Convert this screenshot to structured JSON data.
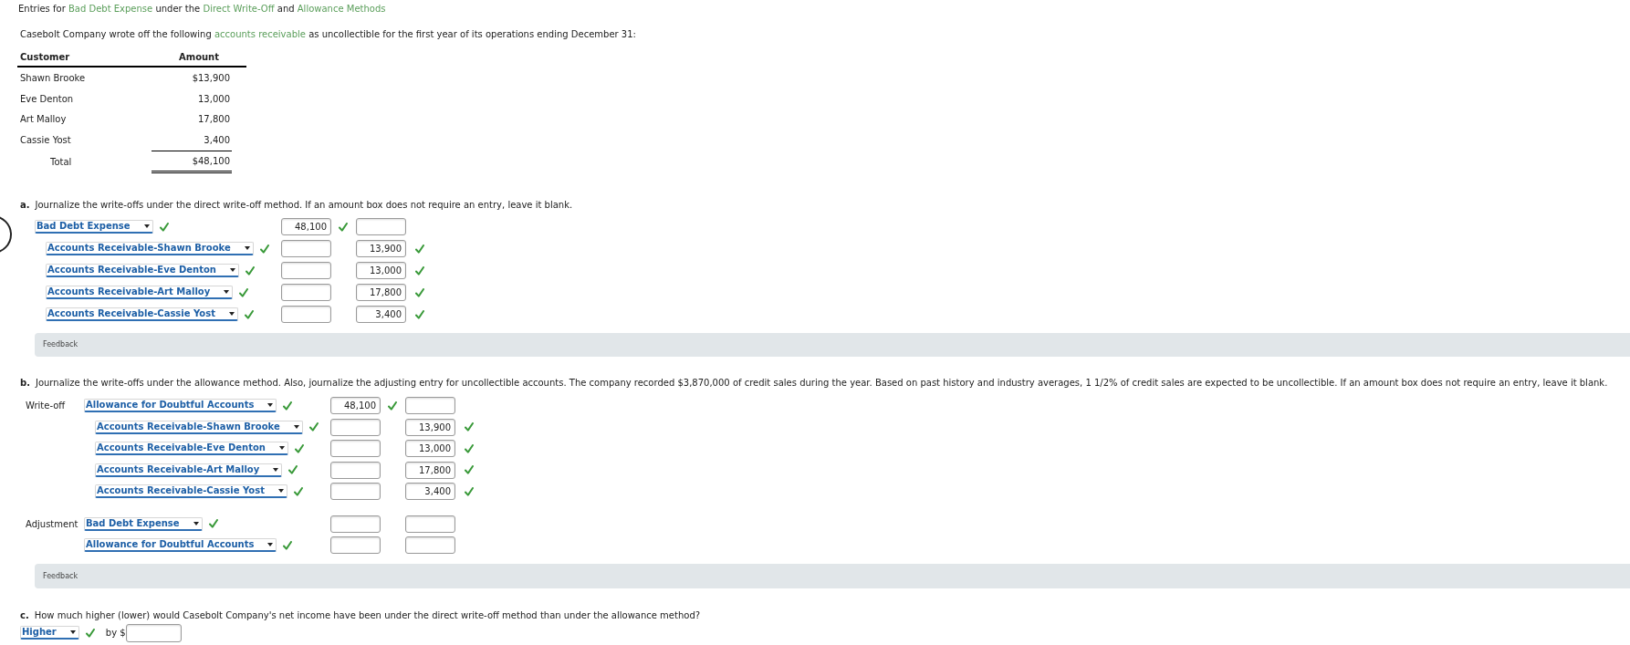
{
  "title": {
    "parts": [
      {
        "kind": "text",
        "text": "Entries for "
      },
      {
        "kind": "link",
        "text": "Bad Debt Expense"
      },
      {
        "kind": "text",
        "text": " under the "
      },
      {
        "kind": "link",
        "text": "Direct Write-Off"
      },
      {
        "kind": "text",
        "text": " and "
      },
      {
        "kind": "link",
        "text": "Allowance Methods"
      }
    ]
  },
  "intro": {
    "parts": [
      {
        "kind": "text",
        "text": "Casebolt Company wrote off the following "
      },
      {
        "kind": "link",
        "text": "accounts receivable"
      },
      {
        "kind": "text",
        "text": " as uncollectible for the first year of its operations ending December 31:"
      }
    ]
  },
  "table": {
    "columns": [
      "Customer",
      "Amount"
    ],
    "rows": [
      {
        "customer": "Shawn Brooke",
        "amount": "$13,900"
      },
      {
        "customer": "Eve Denton",
        "amount": "13,000"
      },
      {
        "customer": "Art Malloy",
        "amount": "17,800"
      },
      {
        "customer": "Cassie Yost",
        "amount": "3,400"
      }
    ],
    "total": {
      "label": "Total",
      "amount": "$48,100"
    }
  },
  "part_a": {
    "letter": "a.",
    "prompt": "Journalize the write-offs under the direct write-off method. If an amount box does not require an entry, leave it blank.",
    "lines": [
      {
        "account": "Bad Debt Expense",
        "account_correct": true,
        "debit": "48,100",
        "debit_correct": true,
        "credit_correct": false,
        "children": [
          {
            "account": "Accounts Receivable-Shawn Brooke",
            "account_correct": true,
            "debit_correct": false,
            "credit": "13,900",
            "credit_correct": true
          },
          {
            "account": "Accounts Receivable-Eve Denton",
            "account_correct": true,
            "debit_correct": false,
            "credit": "13,000",
            "credit_correct": true
          },
          {
            "account": "Accounts Receivable-Art Malloy",
            "account_correct": true,
            "debit_correct": false,
            "credit": "17,800",
            "credit_correct": true
          },
          {
            "account": "Accounts Receivable-Cassie Yost",
            "account_correct": true,
            "debit_correct": false,
            "credit": "3,400",
            "credit_correct": true
          }
        ]
      }
    ],
    "feedback": "Feedback"
  },
  "part_b": {
    "letter": "b.",
    "prompt": "Journalize the write-offs under the allowance method. Also, journalize the adjusting entry for uncollectible accounts. The company recorded $3,870,000 of credit sales during the year. Based on past history and industry averages, 1 1/2% of credit sales are expected to be uncollectible. If an amount box does not require an entry, leave it blank.",
    "groups": [
      {
        "label": "Write-off",
        "lines": [
          {
            "account": "Allowance for Doubtful Accounts",
            "account_correct": true,
            "debit": "48,100",
            "debit_correct": true,
            "credit_correct": false,
            "children": [
              {
                "account": "Accounts Receivable-Shawn Brooke",
                "account_correct": true,
                "debit_correct": false,
                "credit": "13,900",
                "credit_correct": true
              },
              {
                "account": "Accounts Receivable-Eve Denton",
                "account_correct": true,
                "debit_correct": false,
                "credit": "13,000",
                "credit_correct": true
              },
              {
                "account": "Accounts Receivable-Art Malloy",
                "account_correct": true,
                "debit_correct": false,
                "credit": "17,800",
                "credit_correct": true
              },
              {
                "account": "Accounts Receivable-Cassie Yost",
                "account_correct": true,
                "debit_correct": false,
                "credit": "3,400",
                "credit_correct": true
              }
            ]
          }
        ]
      },
      {
        "label": "Adjustment",
        "lines": [
          {
            "account": "Bad Debt Expense",
            "account_correct": true,
            "debit_correct": false,
            "credit_correct": false
          },
          {
            "account": "Allowance for Doubtful Accounts",
            "account_correct": true,
            "debit_correct": false,
            "credit_correct": false
          }
        ]
      }
    ],
    "feedback": "Feedback"
  },
  "part_c": {
    "letter": "c.",
    "prompt": "How much higher (lower) would Casebolt Company's net income have been under the direct write-off method than under the allowance method?",
    "answer": {
      "choice": "Higher",
      "correct": true
    },
    "amount_prefix": "by $"
  }
}
